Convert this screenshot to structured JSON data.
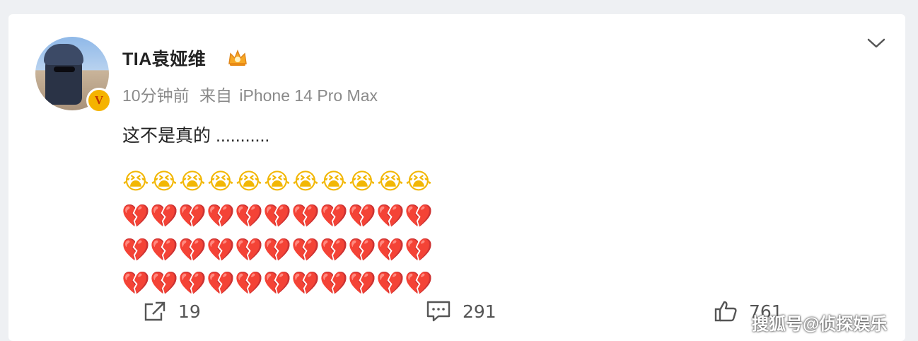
{
  "post": {
    "username": "TIA袁娅维",
    "avatar_badge": "V",
    "time": "10分钟前",
    "source_prefix": "来自",
    "device": "iPhone 14 Pro Max",
    "text": "这不是真的 ...........",
    "emoji_rows": [
      {
        "kind": "cry",
        "glyph": "😭",
        "count": 11
      },
      {
        "kind": "broken-heart",
        "glyph": "💔",
        "count": 11
      },
      {
        "kind": "broken-heart",
        "glyph": "💔",
        "count": 11
      },
      {
        "kind": "broken-heart",
        "glyph": "💔",
        "count": 11
      }
    ]
  },
  "actions": {
    "repost_count": "19",
    "comment_count": "291",
    "like_count": "761"
  },
  "watermark": "搜狐号@侦探娱乐",
  "icons": {
    "more": "chevron-down-icon",
    "repost": "share-icon",
    "comment": "comment-icon",
    "like": "thumbs-up-icon",
    "crown": "crown-icon"
  },
  "colors": {
    "background": "#eef0f3",
    "card": "#ffffff",
    "meta_text": "#8a8a8a",
    "badge": "#f5b300",
    "heart": "#e2262c"
  }
}
